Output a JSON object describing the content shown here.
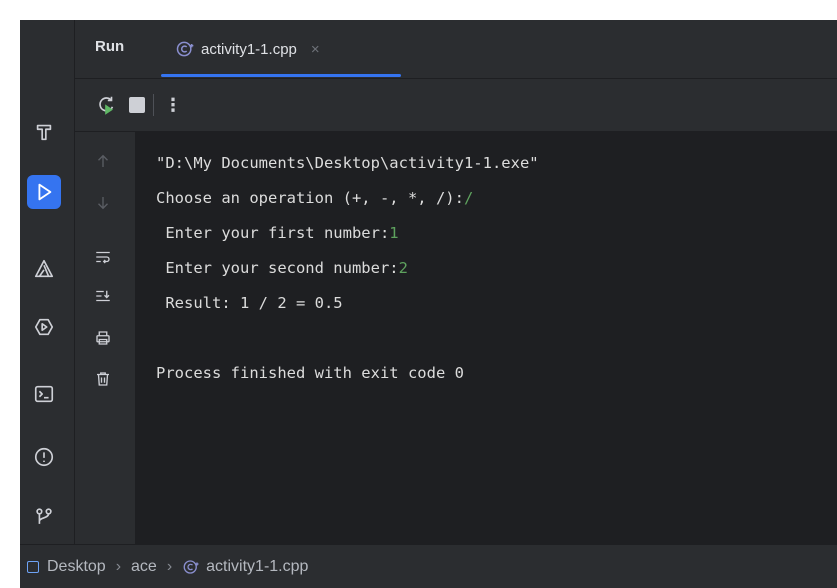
{
  "header": {
    "run_label": "Run",
    "tab_label": "activity1-1.cpp",
    "tab_close": "×"
  },
  "toolbar": {
    "more_label": "⋮"
  },
  "console": {
    "lines": [
      "\"D:\\My Documents\\Desktop\\activity1-1.exe\"",
      "Choose an operation (+, -, *, /):",
      " Enter your first number:",
      " Enter your second number:",
      " Result: 1 / 2 = 0.5",
      "",
      "Process finished with exit code 0"
    ],
    "inputs": {
      "operation": "/",
      "first": "1",
      "second": "2"
    }
  },
  "status": {
    "crumb1": "Desktop",
    "sep": "›",
    "crumb2": "ace",
    "crumb3": "activity1-1.cpp"
  },
  "colors": {
    "accent": "#3574f0",
    "input_green": "#5ea25e",
    "panel": "#2b2d30",
    "console_bg": "#1e1f22"
  }
}
